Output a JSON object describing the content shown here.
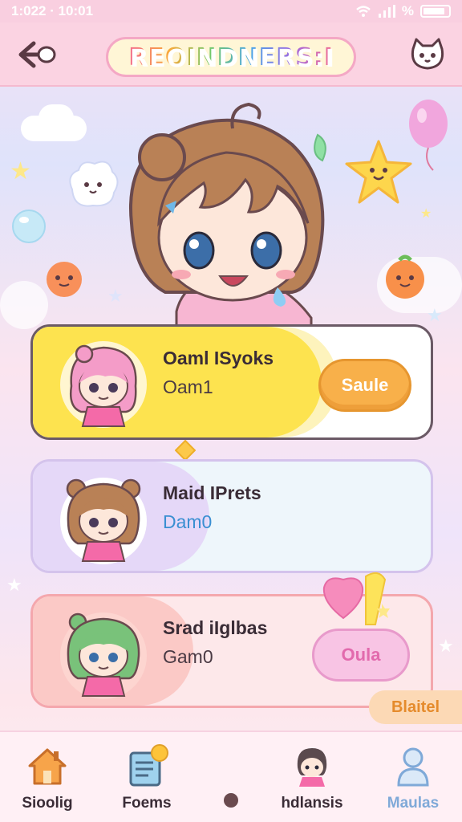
{
  "status_bar": {
    "time": "1:022 · 10:01",
    "battery": "%"
  },
  "header": {
    "title": "REOINDNERS:I",
    "back_icon": "back-arrow-icon",
    "profile_icon": "cat-face-icon"
  },
  "cards": [
    {
      "name": "Oaml ISyoks",
      "sub": "Oam1",
      "button": "Saule",
      "bg": "#fde34f"
    },
    {
      "name": "Maid IPrets",
      "sub": "Dam0",
      "bg": "#e5d8f8"
    },
    {
      "name": "Srad iIglbas",
      "sub": "Gam0",
      "button": "Oula",
      "bg": "#fbc9c6"
    }
  ],
  "badge_button": "Blaitel",
  "bottom_nav": {
    "items": [
      {
        "label": "Sioolig",
        "icon": "house-icon"
      },
      {
        "label": "Foems",
        "icon": "notebook-icon"
      },
      {
        "label": "hdlansis",
        "icon": "character-icon"
      },
      {
        "label": "Maulas",
        "icon": "person-icon"
      }
    ]
  },
  "colors": {
    "header": "#fbd3e2",
    "accent_orange": "#f8b04a",
    "accent_pink": "#f8c4e4",
    "nav_active": "#7fa9d8"
  }
}
